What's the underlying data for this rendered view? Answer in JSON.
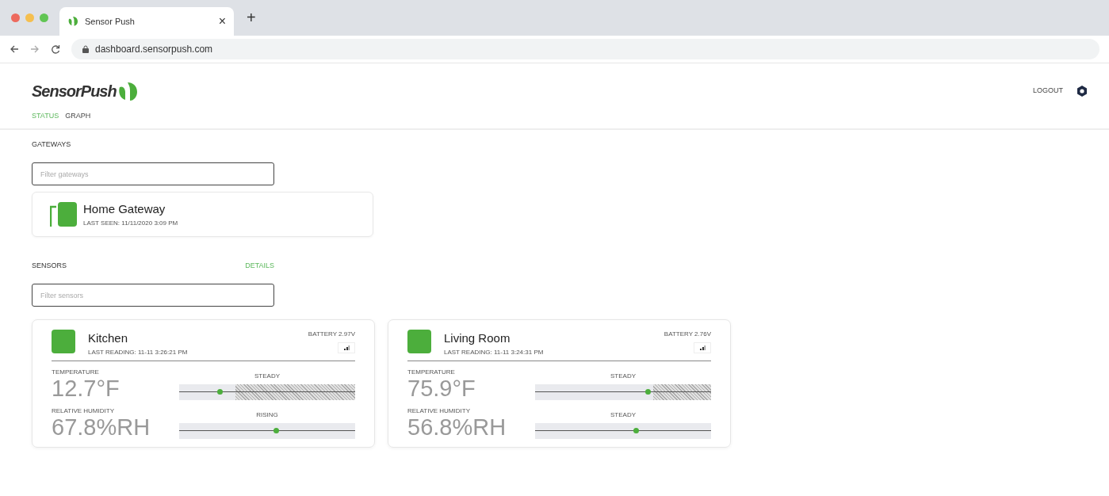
{
  "browser": {
    "tab_title": "Sensor Push",
    "tab_close": "×",
    "new_tab": "+",
    "address": "dashboard.sensorpush.com"
  },
  "header": {
    "brand": "SensorPush",
    "logout": "LOGOUT"
  },
  "nav": [
    {
      "label": "STATUS",
      "selected": true
    },
    {
      "label": "GRAPH",
      "selected": false
    }
  ],
  "gateways": {
    "heading": "GATEWAYS",
    "filter_placeholder": "Filter gateways",
    "items": [
      {
        "name": "Home Gateway",
        "last_seen": "LAST SEEN: 11/11/2020 3:09 PM"
      }
    ]
  },
  "sensors": {
    "heading": "SENSORS",
    "details_link": "DETAILS",
    "filter_placeholder": "Filter sensors",
    "items": [
      {
        "name": "Kitchen",
        "last_reading": "LAST READING: 11-11 3:26:21 PM",
        "battery": "BATTERY 2.97V",
        "metrics": [
          {
            "label": "TEMPERATURE",
            "value": "12.7°F",
            "trend": "STEADY",
            "level": 0.23,
            "hatched": {
              "level": 0.68
            }
          },
          {
            "label": "RELATIVE HUMIDITY",
            "value": "67.8%RH",
            "trend": "RISING",
            "level": 0.55
          }
        ]
      },
      {
        "name": "Living Room",
        "last_reading": "LAST READING: 11-11 3:24:31 PM",
        "battery": "BATTERY 2.76V",
        "metrics": [
          {
            "label": "TEMPERATURE",
            "value": "75.9°F",
            "trend": "STEADY",
            "level": 0.64,
            "hatched": {
              "level": 0.33
            }
          },
          {
            "label": "RELATIVE HUMIDITY",
            "value": "56.8%RH",
            "trend": "STEADY",
            "level": 0.57
          }
        ]
      }
    ]
  }
}
